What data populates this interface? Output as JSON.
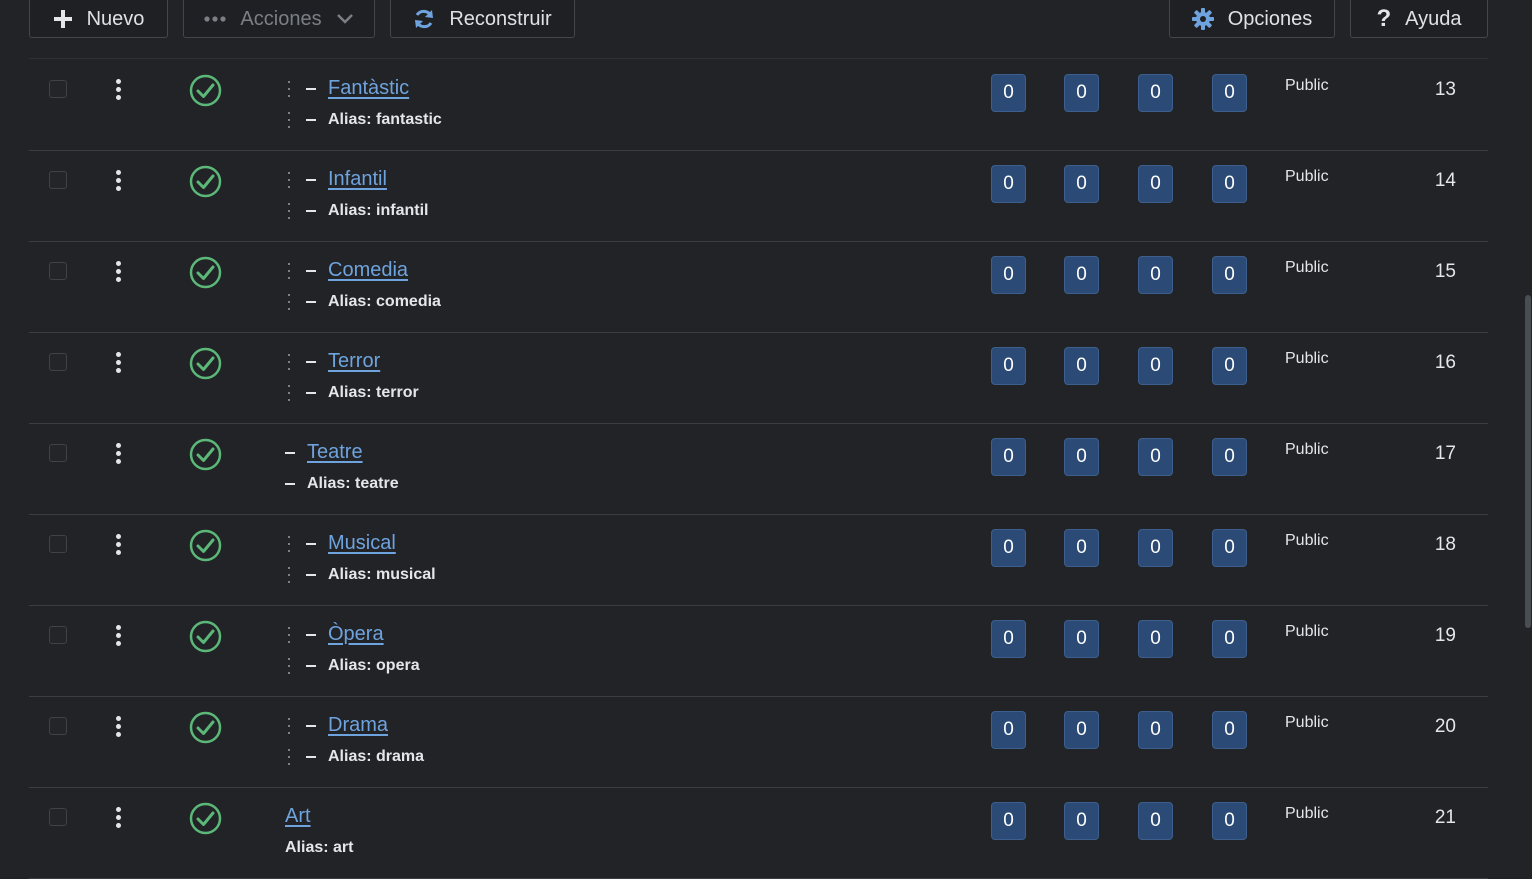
{
  "toolbar": {
    "new_label": "Nuevo",
    "actions_label": "Acciones",
    "rebuild_label": "Reconstruir",
    "options_label": "Opciones",
    "help_label": "Ayuda"
  },
  "colors": {
    "background": "#212326",
    "link": "#6fa3de",
    "badge": "#2b4a75",
    "published": "#5cb878"
  },
  "rows": [
    {
      "title": "Fantàstic",
      "alias": "Alias: fantastic",
      "counts": [
        "0",
        "0",
        "0",
        "0"
      ],
      "access": "Public",
      "id": "13",
      "nested": true
    },
    {
      "title": "Infantil",
      "alias": "Alias: infantil",
      "counts": [
        "0",
        "0",
        "0",
        "0"
      ],
      "access": "Public",
      "id": "14",
      "nested": true
    },
    {
      "title": "Comedia",
      "alias": "Alias: comedia",
      "counts": [
        "0",
        "0",
        "0",
        "0"
      ],
      "access": "Public",
      "id": "15",
      "nested": true
    },
    {
      "title": "Terror",
      "alias": "Alias: terror",
      "counts": [
        "0",
        "0",
        "0",
        "0"
      ],
      "access": "Public",
      "id": "16",
      "nested": true
    },
    {
      "title": "Teatre",
      "alias": "Alias: teatre",
      "counts": [
        "0",
        "0",
        "0",
        "0"
      ],
      "access": "Public",
      "id": "17",
      "nested": false,
      "level": 1
    },
    {
      "title": "Musical",
      "alias": "Alias: musical",
      "counts": [
        "0",
        "0",
        "0",
        "0"
      ],
      "access": "Public",
      "id": "18",
      "nested": true
    },
    {
      "title": "Òpera",
      "alias": "Alias: opera",
      "counts": [
        "0",
        "0",
        "0",
        "0"
      ],
      "access": "Public",
      "id": "19",
      "nested": true
    },
    {
      "title": "Drama",
      "alias": "Alias: drama",
      "counts": [
        "0",
        "0",
        "0",
        "0"
      ],
      "access": "Public",
      "id": "20",
      "nested": true
    },
    {
      "title": "Art",
      "alias": "Alias: art",
      "counts": [
        "0",
        "0",
        "0",
        "0"
      ],
      "access": "Public",
      "id": "21",
      "nested": false,
      "level": 0
    }
  ]
}
